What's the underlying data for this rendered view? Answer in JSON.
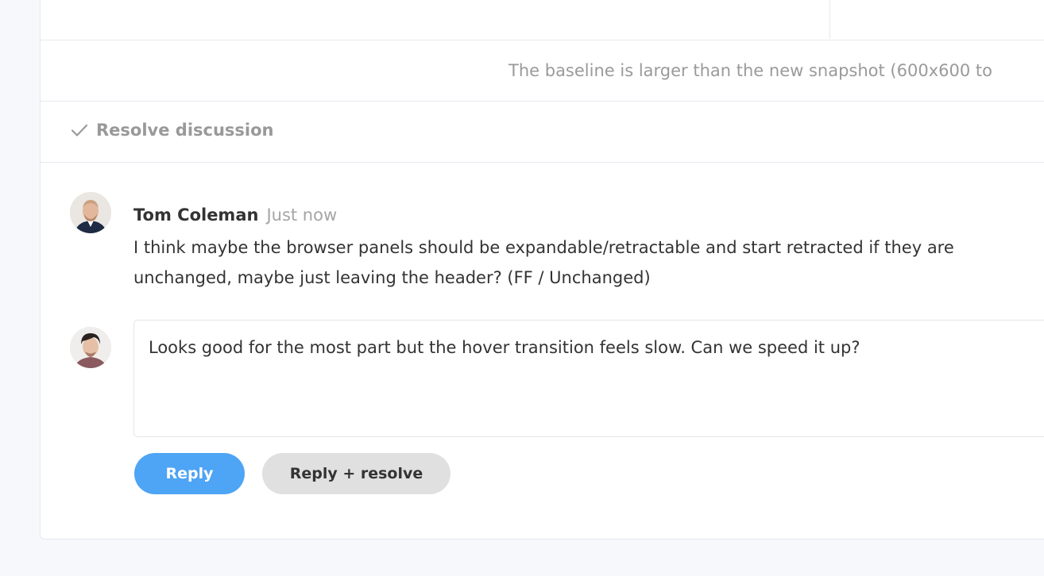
{
  "notice": {
    "text": "The baseline is larger than the new snapshot (600x600 to"
  },
  "resolve": {
    "label": "Resolve discussion",
    "icon": "check-icon"
  },
  "comment": {
    "author": "Tom Coleman",
    "time": "Just now",
    "body": "I think maybe the browser panels should be expandable/retractable and start retracted if they are unchanged, maybe just leaving the header? (FF / Unchanged)",
    "avatar_icon": "avatar-icon"
  },
  "reply": {
    "value": "Looks good for the most part but the hover transition feels slow. Can we speed it up?",
    "avatar_icon": "avatar-icon"
  },
  "buttons": {
    "reply_label": "Reply",
    "reply_resolve_label": "Reply + resolve"
  },
  "colors": {
    "accent": "#4ea4f5",
    "secondary_button": "#e0e0e0",
    "muted_text": "#9a9a9a",
    "border": "#e6e9ee",
    "background": "#f6f8fb"
  }
}
